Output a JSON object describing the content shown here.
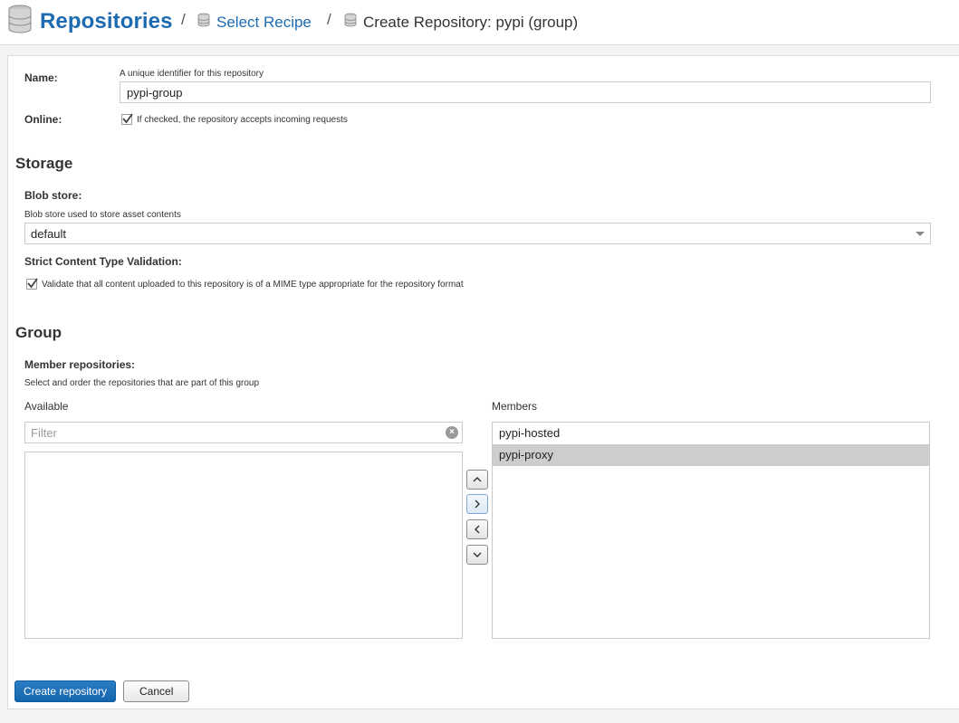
{
  "breadcrumb": {
    "root_title": "Repositories",
    "separator": "/",
    "link_label": "Select Recipe",
    "current_label": "Create Repository: pypi (group)"
  },
  "form": {
    "name": {
      "label": "Name:",
      "help": "A unique identifier for this repository",
      "value": "pypi-group"
    },
    "online": {
      "label": "Online:",
      "checked": true,
      "help": "If checked, the repository accepts incoming requests"
    }
  },
  "storage": {
    "heading": "Storage",
    "blob_store": {
      "label": "Blob store:",
      "help": "Blob store used to store asset contents",
      "value": "default"
    },
    "strict_validation": {
      "label": "Strict Content Type Validation:",
      "checked": true,
      "help": "Validate that all content uploaded to this repository is of a MIME type appropriate for the repository format"
    }
  },
  "group": {
    "heading": "Group",
    "members_label": "Member repositories:",
    "members_help": "Select and order the repositories that are part of this group",
    "available_label": "Available",
    "filter_placeholder": "Filter",
    "available_items": [],
    "members_title": "Members",
    "members": [
      {
        "label": "pypi-hosted",
        "selected": false
      },
      {
        "label": "pypi-proxy",
        "selected": true
      }
    ],
    "buttons": {
      "up": "˄",
      "add": "›",
      "remove": "‹",
      "down": "˅"
    }
  },
  "actions": {
    "create_label": "Create repository",
    "cancel_label": "Cancel"
  }
}
